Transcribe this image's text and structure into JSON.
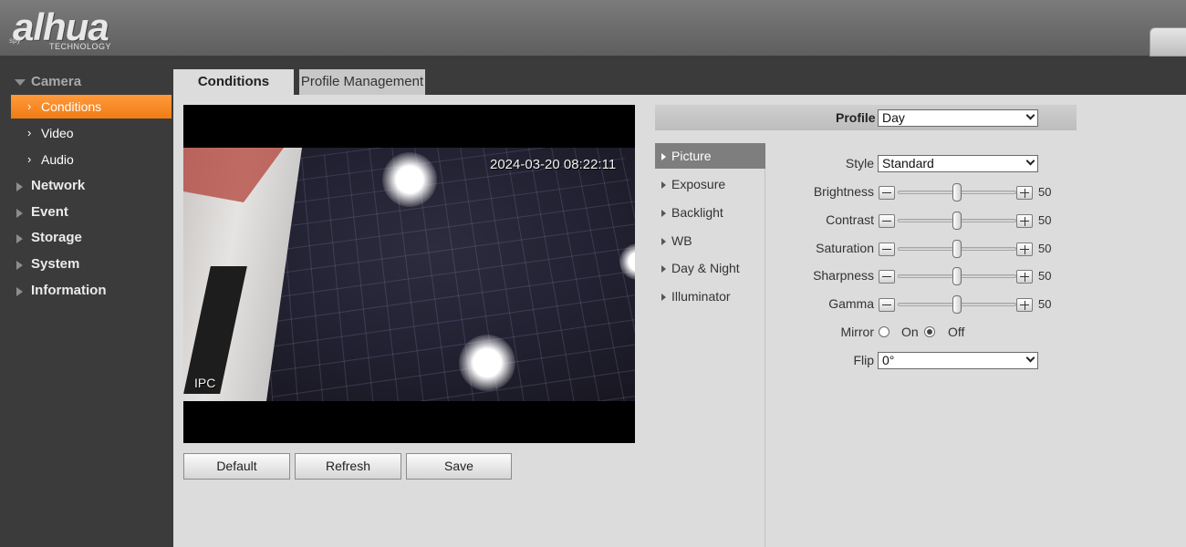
{
  "header": {
    "logo_text": "alhua",
    "logo_sub": "TECHNOLOGY",
    "logo_small": "spy"
  },
  "sidebar": {
    "items": [
      {
        "label": "Camera",
        "expanded": true
      },
      {
        "label": "Network"
      },
      {
        "label": "Event"
      },
      {
        "label": "Storage"
      },
      {
        "label": "System"
      },
      {
        "label": "Information"
      }
    ],
    "camera_subitems": [
      {
        "label": "Conditions",
        "active": true
      },
      {
        "label": "Video"
      },
      {
        "label": "Audio"
      }
    ]
  },
  "tabs": [
    {
      "label": "Conditions",
      "active": true
    },
    {
      "label": "Profile Management"
    }
  ],
  "video": {
    "timestamp": "2024-03-20 08:22:11",
    "channel_label": "IPC"
  },
  "buttons": {
    "default": "Default",
    "refresh": "Refresh",
    "save": "Save"
  },
  "profile": {
    "label": "Profile",
    "value": "Day"
  },
  "submenu": [
    {
      "label": "Picture",
      "active": true
    },
    {
      "label": "Exposure"
    },
    {
      "label": "Backlight"
    },
    {
      "label": "WB"
    },
    {
      "label": "Day & Night"
    },
    {
      "label": "Illuminator"
    }
  ],
  "settings": {
    "style": {
      "label": "Style",
      "value": "Standard"
    },
    "sliders": [
      {
        "label": "Brightness",
        "value": "50",
        "level": 0.5
      },
      {
        "label": "Contrast",
        "value": "50",
        "level": 0.5
      },
      {
        "label": "Saturation",
        "value": "50",
        "level": 0.5
      },
      {
        "label": "Sharpness",
        "value": "50",
        "level": 0.5
      },
      {
        "label": "Gamma",
        "value": "50",
        "level": 0.5
      }
    ],
    "mirror": {
      "label": "Mirror",
      "on_label": "On",
      "off_label": "Off",
      "selected": "Off"
    },
    "flip": {
      "label": "Flip",
      "value": "0°"
    }
  },
  "colors": {
    "active_orange": "#f07c14",
    "sidebar_bg": "#3b3b3b",
    "content_bg": "#dcdcdc"
  }
}
